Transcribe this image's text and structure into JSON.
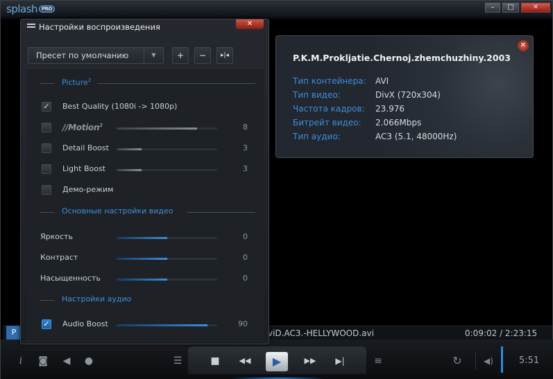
{
  "window": {
    "logo_text": "splash",
    "logo_badge": "PRO",
    "minimize": "–",
    "maximize": "□",
    "close": "✕"
  },
  "settings_panel": {
    "title": "Настройки воспроизведения",
    "close": "✕",
    "preset": "Пресет по умолчанию",
    "preset_dropdown": "▼",
    "add_preset": "+",
    "remove_preset": "−",
    "split_preset": "▸|◂",
    "sections": {
      "picture": "Picture",
      "picture_sup": "2",
      "video": "Основные настройки видео",
      "audio": "Настройки аудио"
    },
    "picture_items": [
      {
        "label": "Best Quality (1080i -> 1080p)",
        "checked": true,
        "check_mark": "✓"
      },
      {
        "label": "//Motion",
        "label_sup": "2",
        "checked": false,
        "value": "8",
        "level": 0.8
      },
      {
        "label": "Detail Boost",
        "checked": false,
        "value": "3",
        "level": 0.25
      },
      {
        "label": "Light Boost",
        "checked": false,
        "value": "3",
        "level": 0.25
      },
      {
        "label": "Демо-режим",
        "checked": false
      }
    ],
    "video_items": [
      {
        "label": "Яркость",
        "value": "0",
        "level": 0.5
      },
      {
        "label": "Контраст",
        "value": "0",
        "level": 0.5
      },
      {
        "label": "Насыщенность",
        "value": "0",
        "level": 0.5
      }
    ],
    "audio_items": [
      {
        "label": "Audio Boost",
        "checked": true,
        "check_mark": "✓",
        "value": "90",
        "level": 0.9
      }
    ]
  },
  "info_card": {
    "close": "✕",
    "title": "P.K.M.Prokljatie.Chernoj.zhemchuzhiny.2003",
    "rows": [
      {
        "key": "Тип контейнера:",
        "value": "AVI"
      },
      {
        "key": "Тип видео:",
        "value": "DivX (720x304)"
      },
      {
        "key": "Частота кадров:",
        "value": "23.976"
      },
      {
        "key": "Битрейт видео:",
        "value": "2.066Mbps"
      },
      {
        "key": "Тип аудио:",
        "value": "AC3 (5.1, 48000Hz)"
      }
    ]
  },
  "player": {
    "playlist_tab": "P",
    "file_name": "viD.AC3.-HELLYWOOD.avi",
    "position": "0:09:02 / 2:23:15",
    "time_remaining": "5:51",
    "icons": {
      "info": "i",
      "screenshot": "◙",
      "audio": "◀",
      "subtitles": "●",
      "settings": "☰",
      "stop": "■",
      "rewind": "◀◀",
      "play": "▶",
      "forward": "▶▶",
      "next": "▶|",
      "playlist": "≡",
      "repeat": "↻",
      "volume": "◀)"
    }
  },
  "colors": {
    "accent": "#3d8fdc",
    "close_red": "#c0392b",
    "panel_bg": "#1e2226"
  }
}
